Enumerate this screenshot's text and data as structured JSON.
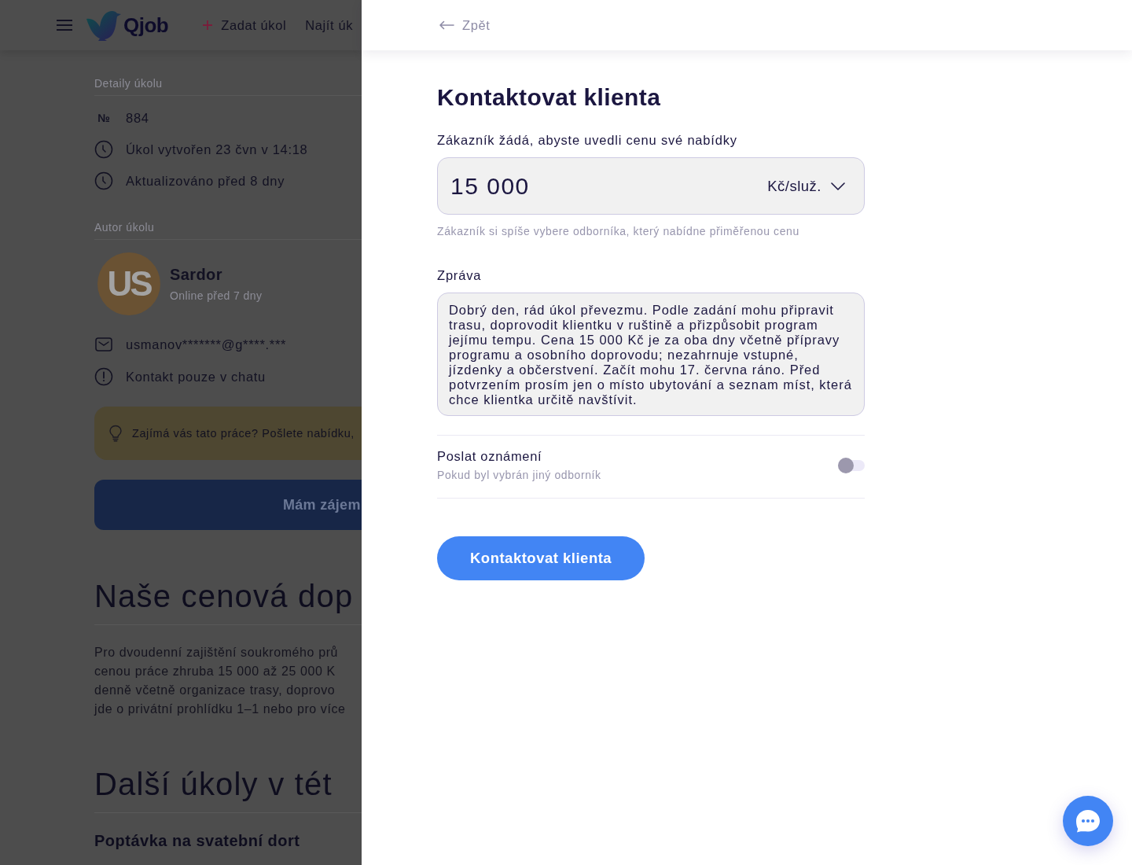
{
  "background_page": {
    "header": {
      "logo_text": "Qjob",
      "nav": [
        {
          "kind": "add",
          "label": "Zadat úkol"
        },
        {
          "kind": "plain",
          "label": "Najít úk"
        }
      ]
    },
    "details": {
      "title": "Detaily úkolu",
      "items": [
        {
          "kind": "number",
          "symbol": "№",
          "text": "884"
        },
        {
          "kind": "clock",
          "text": "Úkol vytvořen 23 čvn v 14:18"
        },
        {
          "kind": "clock",
          "text": "Aktualizováno před 8 dny"
        }
      ]
    },
    "author": {
      "title": "Autor úkolu",
      "initials": "US",
      "name": "Sardor",
      "status": "Online před 7 dny",
      "contacts": [
        {
          "kind": "mail",
          "text": "usmanov*******@g****.***"
        },
        {
          "kind": "alert",
          "text": "Kontakt pouze v chatu"
        }
      ]
    },
    "notice": "Zajímá vás tato práce? Pošlete nabídku,",
    "interest_button": "Mám zájem",
    "price_section": {
      "title": "Naše cenová dop",
      "lines": [
        "Pro dvoudenní zajištění soukromého prů",
        "cenou práce zhruba 15 000 až 25 000 K",
        "denně včetně organizace trasy, doprovo",
        "jde o privátní prohlídku 1–1 nebo pro více"
      ]
    },
    "more_tasks": {
      "title": "Další úkoly v tét",
      "first_task": "Poptávka na svatební dort"
    }
  },
  "drawer": {
    "back": "Zpět",
    "title": "Kontaktovat klienta",
    "price_label": "Zákazník žádá, abyste uvedli cenu své nabídky",
    "price_value": "15 000",
    "unit": "Kč/služ.",
    "price_hint": "Zákazník si spíše vybere odborníka, který nabídne přiměřenou cenu",
    "message_label": "Zpráva",
    "message": "Dobrý den, rád úkol převezmu. Podle zadání mohu připravit trasu, doprovodit klientku v ruštině a přizpůsobit program jejímu tempu. Cena 15 000 Kč je za oba dny včetně přípravy programu a osobního doprovodu; nezahrnuje vstupné, jízdenky a občerstvení. Začít mohu 17. června ráno. Před potvrzením prosím jen o místo ubytování a seznam míst, která chce klientka určitě navštívit.",
    "notify": {
      "label": "Poslat oznámení",
      "hint": "Pokud byl vybrán jiný odborník",
      "on": false
    },
    "submit": "Kontaktovat klienta"
  }
}
